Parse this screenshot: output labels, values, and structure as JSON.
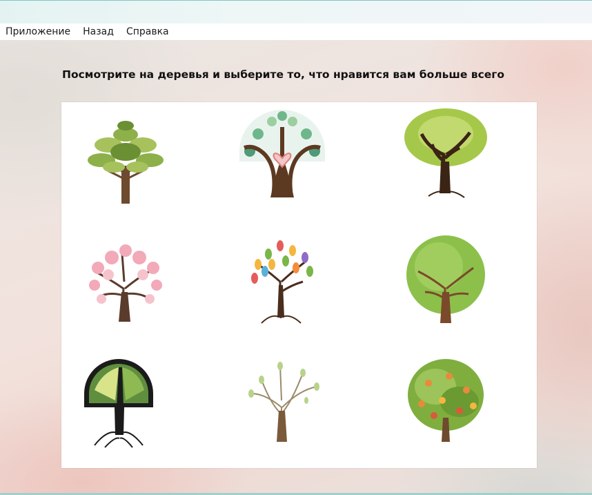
{
  "window": {
    "accent_color": "#7cc7c4"
  },
  "menu": {
    "items": [
      {
        "label": "Приложение"
      },
      {
        "label": "Назад"
      },
      {
        "label": "Справка"
      }
    ]
  },
  "main": {
    "question": "Посмотрите на деревья и выберите то, что нравится вам больше всего"
  },
  "trees": [
    {
      "name": "green-leafy-tree",
      "palette": [
        "#8db04b",
        "#6b8f33"
      ]
    },
    {
      "name": "heart-trunk-tree",
      "palette": [
        "#6fb78a",
        "#e07c7c"
      ]
    },
    {
      "name": "swirl-branch-tree",
      "palette": [
        "#a6c84a",
        "#3b2415"
      ]
    },
    {
      "name": "cherry-blossom-tree",
      "palette": [
        "#f2a9b8",
        "#5a3b2c"
      ]
    },
    {
      "name": "colorful-leaves-tree",
      "palette": [
        "#f4b63f",
        "#7ab648"
      ]
    },
    {
      "name": "round-green-tree",
      "palette": [
        "#8cc04b",
        "#7b4a2a"
      ]
    },
    {
      "name": "stained-glass-tree",
      "palette": [
        "#5f8f3e",
        "#1b1b1b"
      ]
    },
    {
      "name": "bare-sparse-tree",
      "palette": [
        "#b9d28a",
        "#7a5a3a"
      ]
    },
    {
      "name": "fruit-tree",
      "palette": [
        "#7fae3f",
        "#e98a3a"
      ]
    }
  ]
}
